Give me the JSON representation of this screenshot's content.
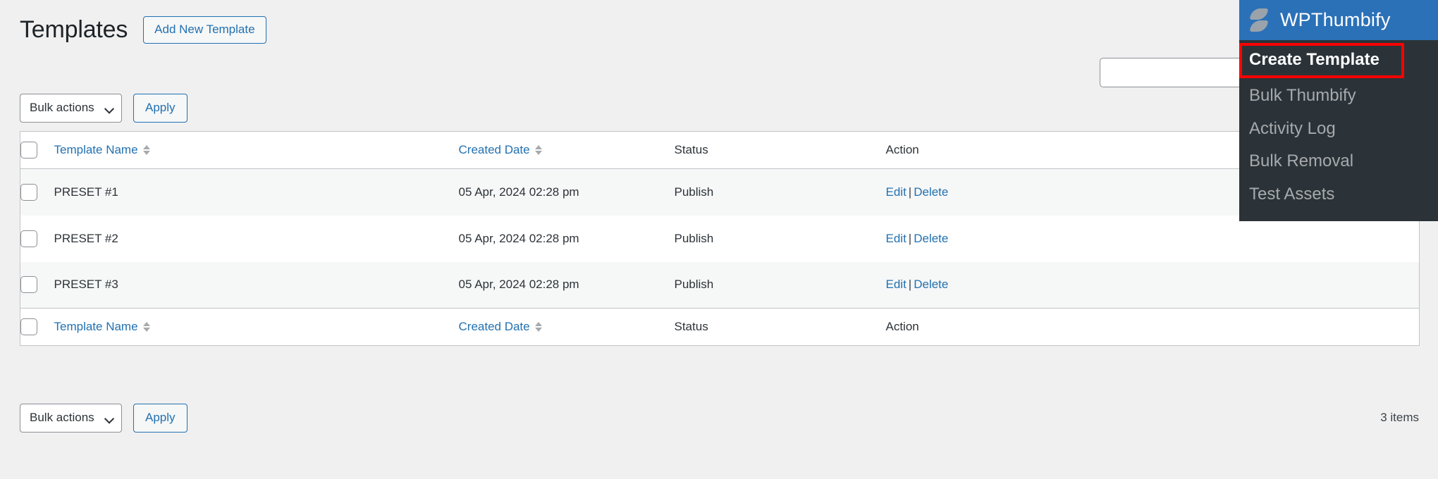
{
  "header": {
    "title": "Templates",
    "add_new_label": "Add New Template"
  },
  "search": {
    "value": "",
    "placeholder": ""
  },
  "bulk_top": {
    "select_value": "Bulk actions",
    "apply_label": "Apply",
    "chevron_icon": "chevron-down-icon"
  },
  "bulk_bottom": {
    "select_value": "Bulk actions",
    "apply_label": "Apply",
    "chevron_icon": "chevron-down-icon"
  },
  "table": {
    "columns": {
      "checkbox": "",
      "name": "Template Name",
      "date": "Created Date",
      "status": "Status",
      "action": "Action"
    },
    "sort_icon": "sort-arrows-icon",
    "rows": [
      {
        "name": "PRESET #1",
        "date": "05 Apr, 2024 02:28 pm",
        "status": "Publish",
        "edit": "Edit",
        "separator": "|",
        "delete": "Delete"
      },
      {
        "name": "PRESET #2",
        "date": "05 Apr, 2024 02:28 pm",
        "status": "Publish",
        "edit": "Edit",
        "separator": "|",
        "delete": "Delete"
      },
      {
        "name": "PRESET #3",
        "date": "05 Apr, 2024 02:28 pm",
        "status": "Publish",
        "edit": "Edit",
        "separator": "|",
        "delete": "Delete"
      }
    ]
  },
  "footer": {
    "items_count": "3 items"
  },
  "wpthumbify_panel": {
    "brand_title": "WPThumbify",
    "logo_icon": "wpthumbify-logo-icon",
    "brand_color": "#2b71b8",
    "menu_bg_color": "#2b3338",
    "highlight_color": "#ff0000",
    "items": [
      {
        "label": "Create Template",
        "active": true
      },
      {
        "label": "Bulk Thumbify",
        "active": false
      },
      {
        "label": "Activity Log",
        "active": false
      },
      {
        "label": "Bulk Removal",
        "active": false
      },
      {
        "label": "Test Assets",
        "active": false
      }
    ]
  },
  "colors": {
    "link": "#2271b1",
    "page_bg": "#f0f0f1",
    "row_alt": "#f6f7f7"
  }
}
